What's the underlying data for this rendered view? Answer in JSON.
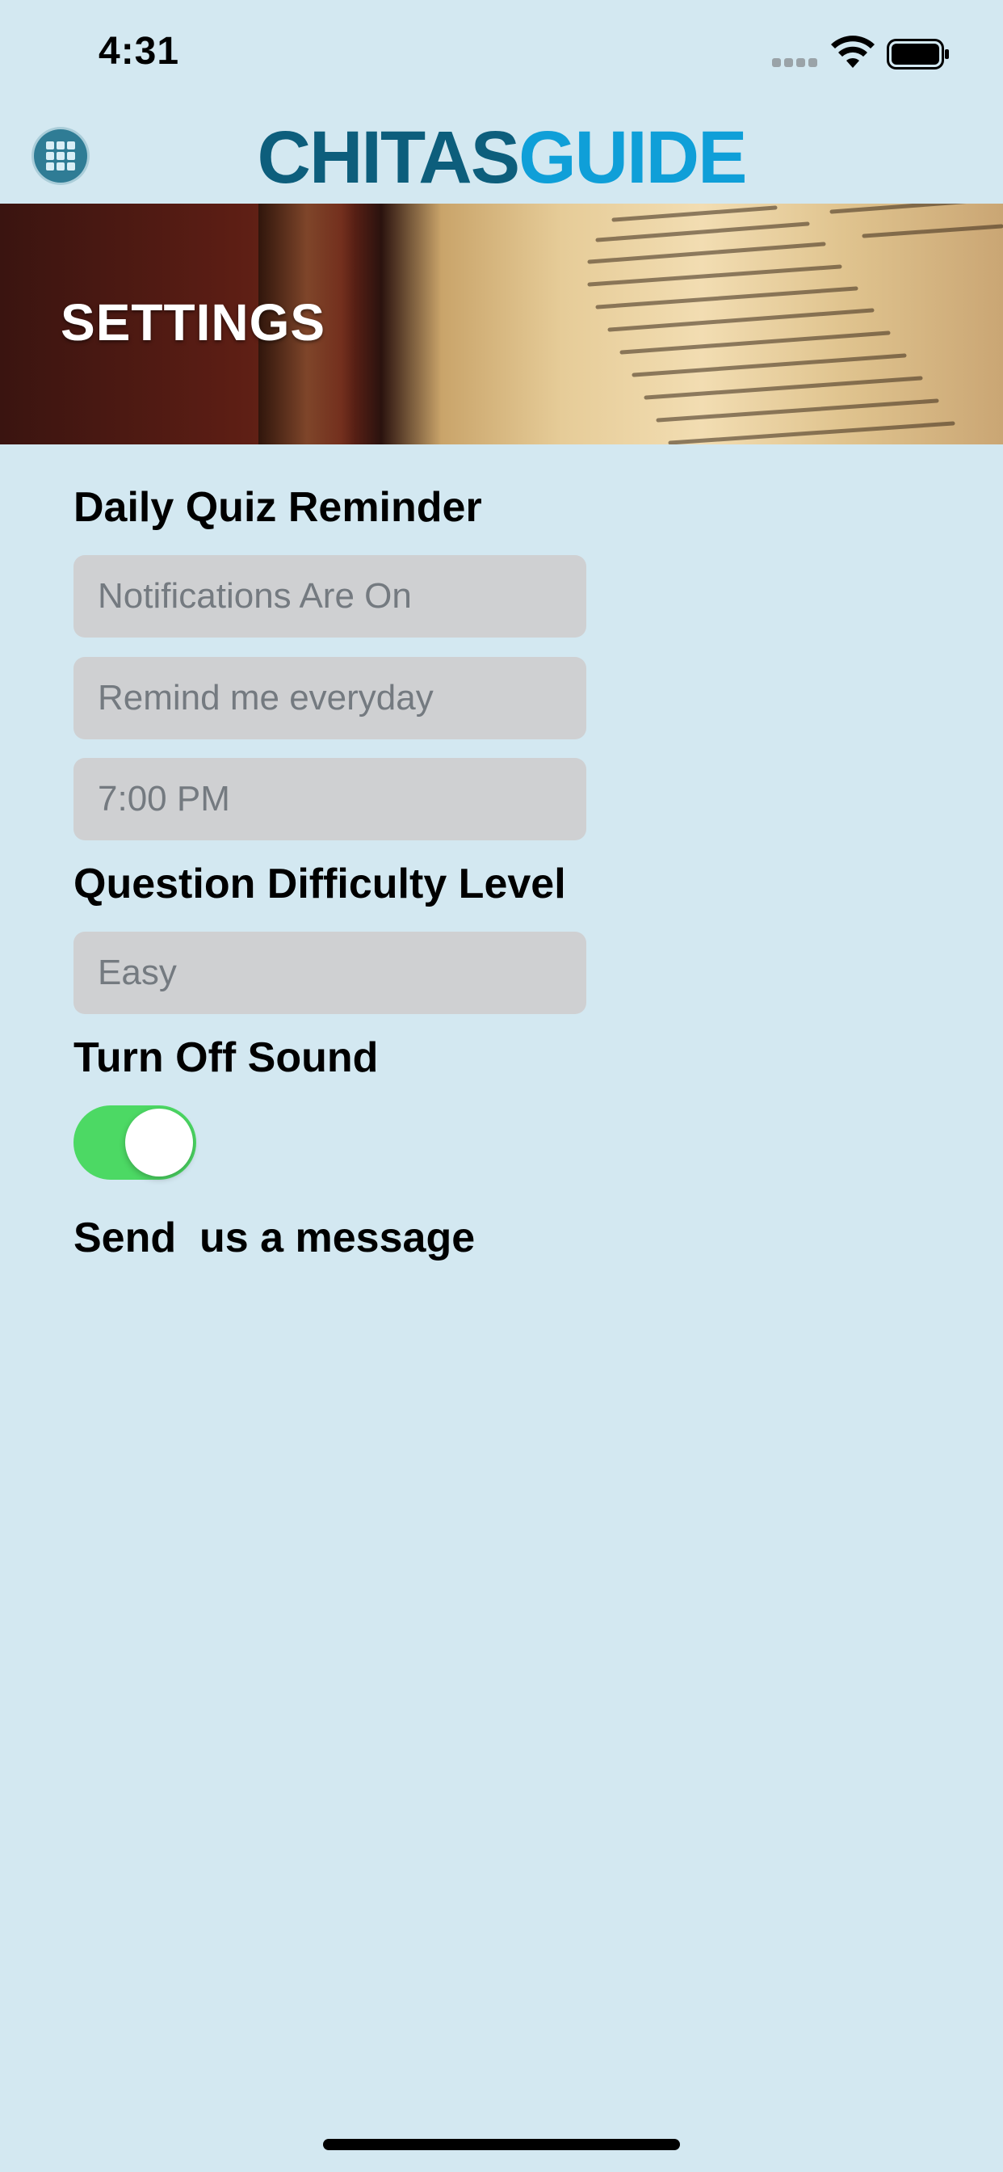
{
  "status_bar": {
    "time": "4:31",
    "icons": [
      "signal-icon",
      "wifi-icon",
      "battery-icon"
    ]
  },
  "header": {
    "menu_icon": "grid-icon",
    "logo_part1": "CHITAS",
    "logo_part2": "GUIDE",
    "logo_colors": {
      "part1": "#0d5e7c",
      "part2": "#0f9fd8"
    }
  },
  "banner": {
    "title": "SETTINGS"
  },
  "settings": {
    "reminder_label": "Daily Quiz Reminder",
    "notifications_value": "Notifications Are On",
    "frequency_value": "Remind me everyday",
    "time_value": "7:00 PM",
    "difficulty_label": "Question Difficulty Level",
    "difficulty_value": "Easy",
    "sound_label": "Turn Off Sound",
    "sound_toggle_on": true,
    "message_link": "Send  us a message"
  },
  "colors": {
    "background": "#d3e8f1",
    "field": "#cfd0d2",
    "toggle_on": "#4cd964"
  }
}
